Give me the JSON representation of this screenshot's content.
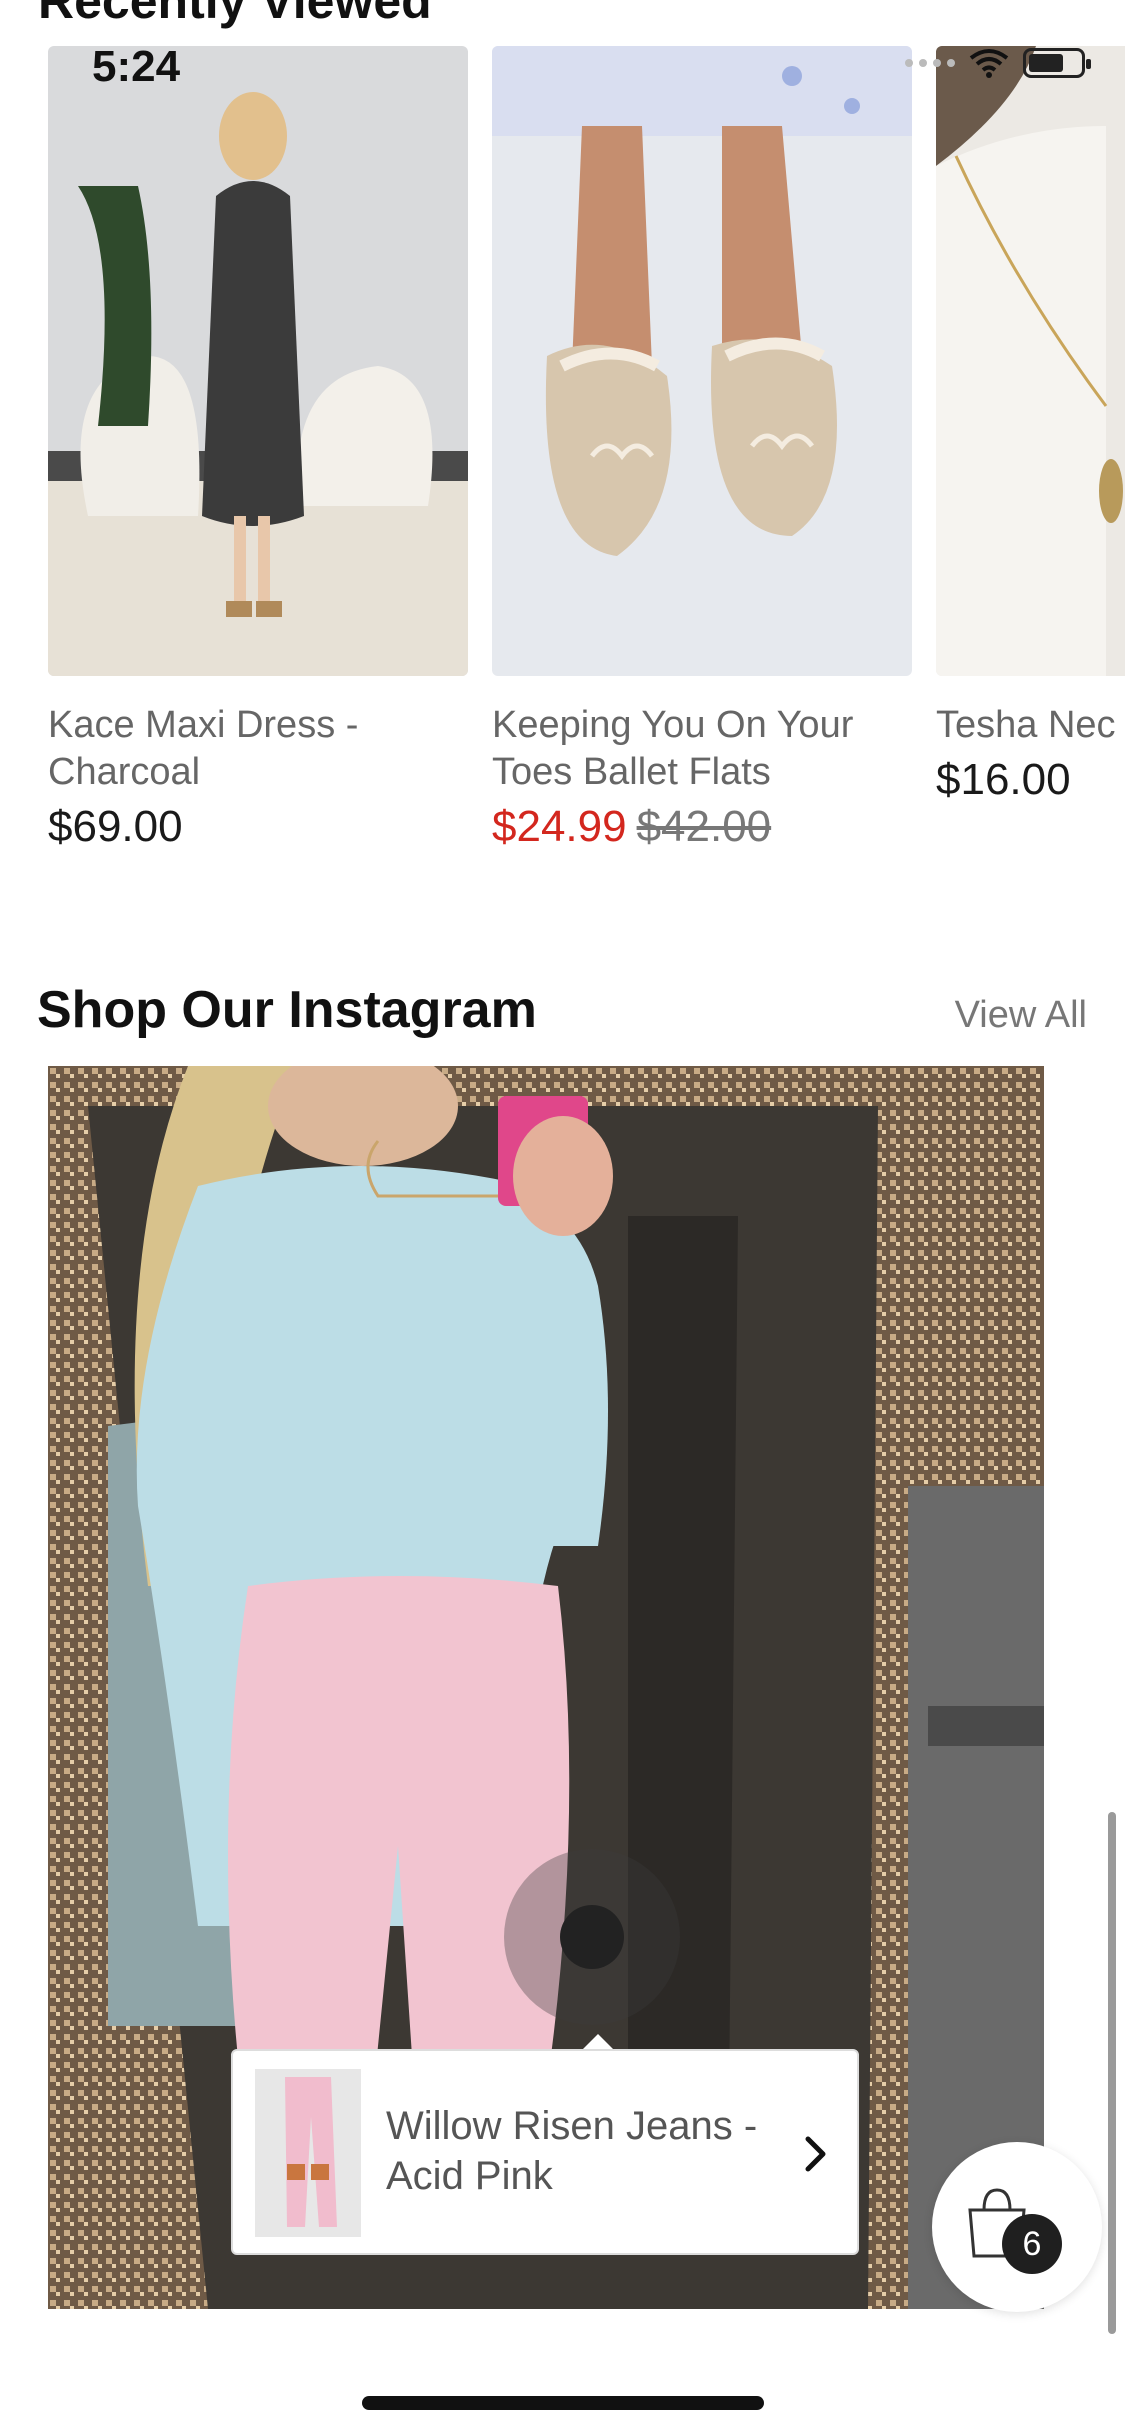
{
  "status_bar": {
    "time": "5:24"
  },
  "section_above": {
    "title_clipped": "Recently Viewed"
  },
  "products": [
    {
      "name": "Kace Maxi Dress - Charcoal",
      "price": "$69.00"
    },
    {
      "name": "Keeping You On Your Toes Ballet Flats",
      "sale_price": "$24.99",
      "original_price": "$42.00"
    },
    {
      "name": "Tesha Nec",
      "price": "$16.00"
    }
  ],
  "instagram": {
    "title": "Shop Our Instagram",
    "view_all": "View All",
    "tagged_product": {
      "name": "Willow Risen Jeans - Acid Pink"
    }
  },
  "cart": {
    "count": "6"
  },
  "colors": {
    "sale_red": "#d3271e",
    "text_dark": "#1a1a1a",
    "text_muted": "#666666"
  },
  "icons": [
    "wifi-icon",
    "battery-icon",
    "chevron-right-icon",
    "shopping-bag-icon"
  ]
}
